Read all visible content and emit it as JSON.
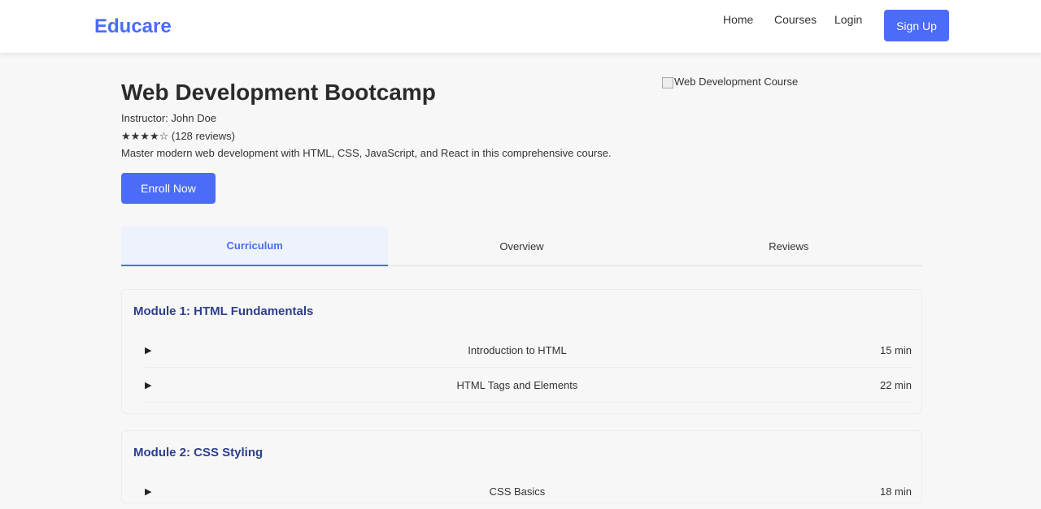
{
  "header": {
    "logo": "Educare",
    "nav": [
      {
        "label": "Home"
      },
      {
        "label": "Courses"
      },
      {
        "label": "Login"
      }
    ],
    "signup_label": "Sign Up"
  },
  "course": {
    "title": "Web Development Bootcamp",
    "instructor": "Instructor: John Doe",
    "rating": "★★★★☆ (128 reviews)",
    "description": "Master modern web development with HTML, CSS, JavaScript, and React in this comprehensive course.",
    "enroll_label": "Enroll Now",
    "image_alt": "Web Development Course"
  },
  "tabs": [
    {
      "label": "Curriculum",
      "active": true
    },
    {
      "label": "Overview",
      "active": false
    },
    {
      "label": "Reviews",
      "active": false
    }
  ],
  "modules": [
    {
      "title": "Module 1: HTML Fundamentals",
      "lessons": [
        {
          "name": "Introduction to HTML",
          "duration": "15 min"
        },
        {
          "name": "HTML Tags and Elements",
          "duration": "22 min"
        }
      ]
    },
    {
      "title": "Module 2: CSS Styling",
      "lessons": [
        {
          "name": "CSS Basics",
          "duration": "18 min"
        }
      ]
    }
  ],
  "colors": {
    "accent": "#4a6cf7",
    "module_title": "#2d3f8c",
    "active_tab_bg": "#eef2fd"
  },
  "icons": {
    "play": "play-icon",
    "broken_image": "broken-image-icon"
  }
}
